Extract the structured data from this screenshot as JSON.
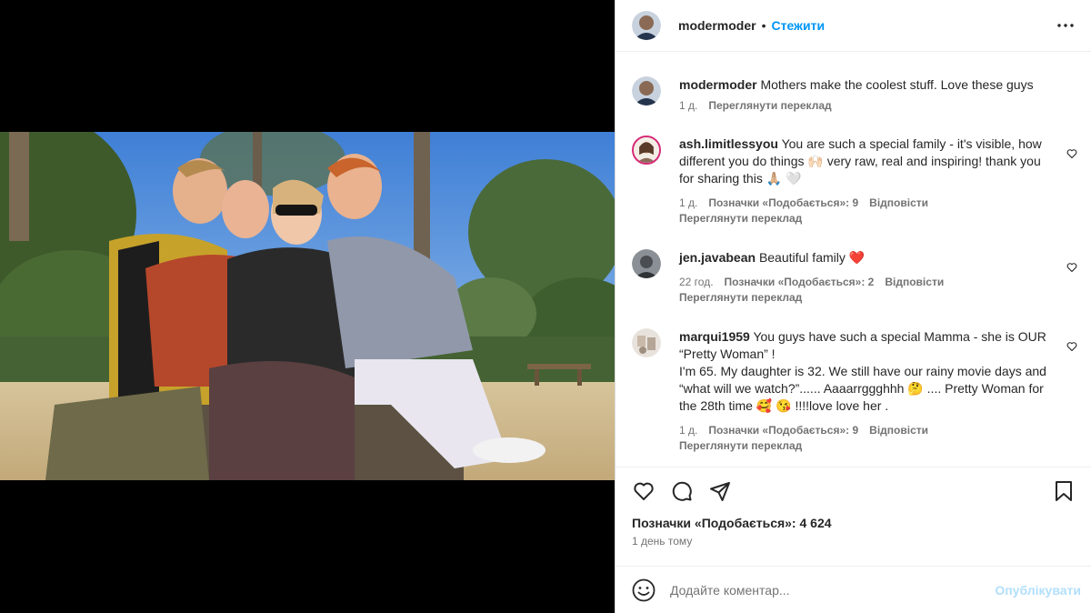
{
  "colors": {
    "accent": "#0095f6",
    "muted": "#737373",
    "text": "#262626",
    "publish_disabled": "#b2dffc",
    "heart_red": "#ed4956"
  },
  "header": {
    "username": "modermoder",
    "follow_label": "Стежити"
  },
  "caption": {
    "username": "modermoder",
    "text": "Mothers make the coolest stuff. Love these guys",
    "time": "1 д.",
    "translate": "Переглянути переклад"
  },
  "comments": [
    {
      "username": "ash.limitlessyou",
      "text": "You are such a special family - it's visible, how different you do things 🙌🏻 very raw, real and inspiring! thank you for sharing this 🙏🏼 🤍",
      "time": "1 д.",
      "likes": "Позначки «Подобається»: 9",
      "reply": "Відповісти",
      "translate": "Переглянути переклад"
    },
    {
      "username": "jen.javabean",
      "text": "Beautiful family ❤️",
      "time": "22 год.",
      "likes": "Позначки «Подобається»: 2",
      "reply": "Відповісти",
      "translate": "Переглянути переклад"
    },
    {
      "username": "marqui1959",
      "text": "You guys have such a special Mamma - she is OUR “Pretty Woman” !",
      "text2": "I'm 65. My daughter is 32. We still have our rainy movie days and “what will we watch?”...... Aaaarrggghhh 🤔 .... Pretty Woman for the 28th time 🥰 😘 !!!!love love her .",
      "time": "1 д.",
      "likes": "Позначки «Подобається»: 9",
      "reply": "Відповісти",
      "translate": "Переглянути переклад"
    }
  ],
  "actions": {
    "likes_label": "Позначки «Подобається»: 4 624",
    "posted": "1 день тому"
  },
  "composer": {
    "placeholder": "Додайте коментар...",
    "publish_label": "Опублікувати"
  },
  "icons": {
    "more": "more-options-icon",
    "like": "heart-icon",
    "comment": "comment-icon",
    "share": "share-icon",
    "save": "bookmark-icon",
    "emoji": "emoji-icon"
  }
}
